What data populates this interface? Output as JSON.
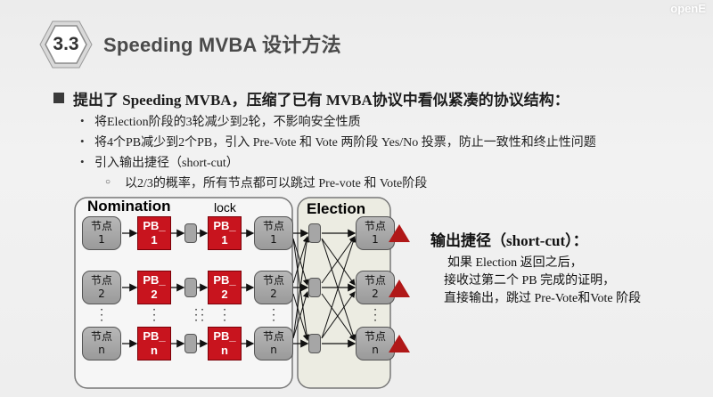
{
  "brand": "openE",
  "section_number": "3.3",
  "title": "Speeding MVBA 设计方法",
  "bullet_main": "提出了 Speeding MVBA，压缩了已有 MVBA协议中看似紧凑的协议结构：",
  "sub_bullets": [
    "将Election阶段的3轮减少到2轮，不影响安全性质",
    "将4个PB减少到2个PB，引入 Pre-Vote 和 Vote 两阶段 Yes/No 投票，防止一致性和终止性问题",
    "引入输出捷径（short-cut）"
  ],
  "sub_sub_bullet": "以2/3的概率，所有节点都可以跳过 Pre-vote 和 Vote阶段",
  "diagram": {
    "nomination_label": "Nomination",
    "lock_label": "lock",
    "election_label": "Election",
    "node_text": "节点",
    "pb_text": "PB_",
    "rows": [
      {
        "index": "1"
      },
      {
        "index": "2"
      },
      {
        "index": "n"
      }
    ],
    "colors": {
      "pb": "#c8141e",
      "triangle": "#b01818",
      "node": "#a8a8a8"
    }
  },
  "shortcut": {
    "title": "输出捷径（short-cut）：",
    "lines": [
      "如果 Election 返回之后，",
      "接收过第二个 PB 完成的证明，",
      "直接输出，跳过 Pre-Vote和Vote 阶段"
    ]
  },
  "icons": [
    "hexagon-badge-icon",
    "bullet-square-icon",
    "bullet-dot-icon",
    "bullet-circle-icon",
    "warning-triangle-icon"
  ]
}
